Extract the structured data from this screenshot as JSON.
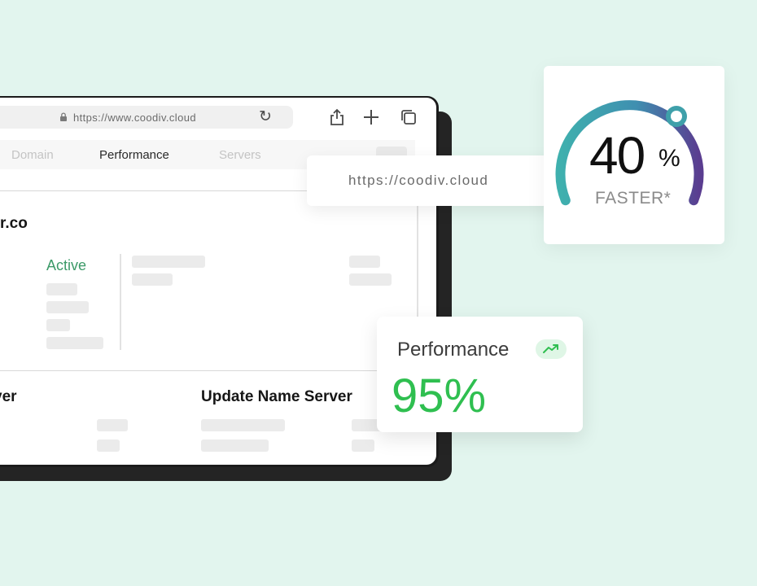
{
  "browser": {
    "url": "https://www.coodiv.cloud",
    "tabs": [
      {
        "label": "Domain",
        "active": false
      },
      {
        "label": "Performance",
        "active": true
      },
      {
        "label": "Servers",
        "active": false
      }
    ],
    "domain_name_partial": "r.co",
    "status": "Active",
    "section_left_partial": "ver",
    "section_right": "Update Name Server"
  },
  "url_card": {
    "url": "https://coodiv.cloud"
  },
  "gauge_card": {
    "value": "40",
    "unit": "%",
    "label": "FASTER*",
    "gradient_colors": [
      "#3fb0ae",
      "#5a3d90"
    ]
  },
  "performance_card": {
    "title": "Performance",
    "value": "95%",
    "trend_icon": "trending-up-icon",
    "value_color": "#2fbf50"
  }
}
